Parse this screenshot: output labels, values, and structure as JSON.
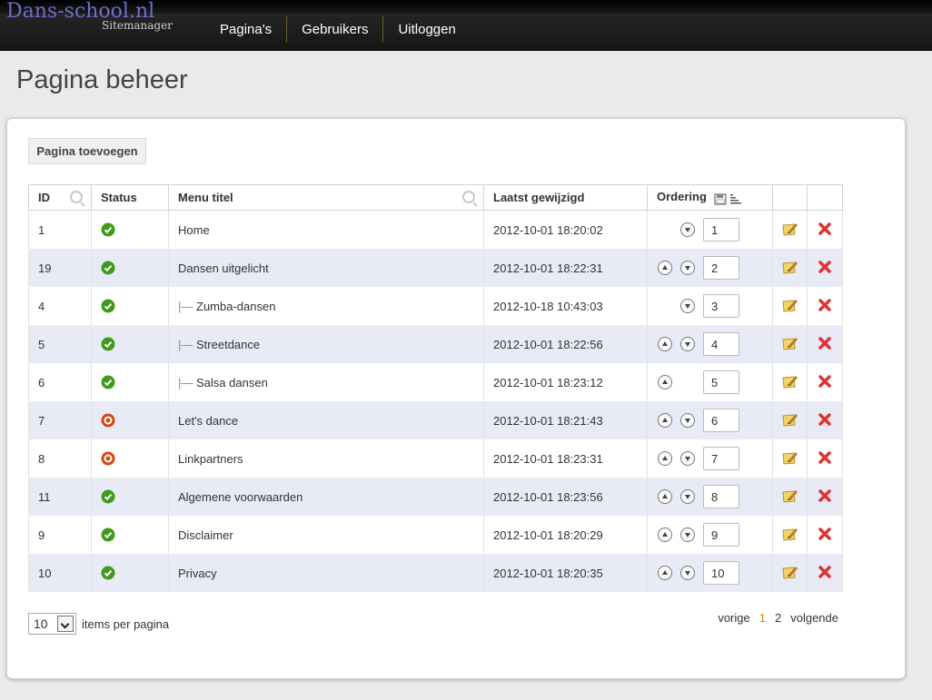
{
  "app": {
    "brand": "Dans-school.nl",
    "subtitle": "Sitemanager"
  },
  "nav": {
    "items": [
      "Pagina's",
      "Gebruikers",
      "Uitloggen"
    ]
  },
  "page": {
    "title": "Pagina beheer"
  },
  "toolbar": {
    "add_label": "Pagina toevoegen"
  },
  "table": {
    "columns": {
      "id": "ID",
      "status": "Status",
      "title": "Menu titel",
      "modified": "Laatst gewijzigd",
      "ordering": "Ordering"
    },
    "rows": [
      {
        "id": "1",
        "status": "active",
        "title": "Home",
        "child": false,
        "modified": "2012-10-01 18:20:02",
        "order": "1",
        "up": false,
        "down": true
      },
      {
        "id": "19",
        "status": "active",
        "title": "Dansen uitgelicht",
        "child": false,
        "modified": "2012-10-01 18:22:31",
        "order": "2",
        "up": true,
        "down": true
      },
      {
        "id": "4",
        "status": "active",
        "title": "Zumba-dansen",
        "child": true,
        "modified": "2012-10-18 10:43:03",
        "order": "3",
        "up": false,
        "down": true
      },
      {
        "id": "5",
        "status": "active",
        "title": "Streetdance",
        "child": true,
        "modified": "2012-10-01 18:22:56",
        "order": "4",
        "up": true,
        "down": true
      },
      {
        "id": "6",
        "status": "active",
        "title": "Salsa dansen",
        "child": true,
        "modified": "2012-10-01 18:23:12",
        "order": "5",
        "up": true,
        "down": false
      },
      {
        "id": "7",
        "status": "inactive",
        "title": "Let's dance",
        "child": false,
        "modified": "2012-10-01 18:21:43",
        "order": "6",
        "up": true,
        "down": true
      },
      {
        "id": "8",
        "status": "inactive",
        "title": "Linkpartners",
        "child": false,
        "modified": "2012-10-01 18:23:31",
        "order": "7",
        "up": true,
        "down": true
      },
      {
        "id": "11",
        "status": "active",
        "title": "Algemene voorwaarden",
        "child": false,
        "modified": "2012-10-01 18:23:56",
        "order": "8",
        "up": true,
        "down": true
      },
      {
        "id": "9",
        "status": "active",
        "title": "Disclaimer",
        "child": false,
        "modified": "2012-10-01 18:20:29",
        "order": "9",
        "up": true,
        "down": true
      },
      {
        "id": "10",
        "status": "active",
        "title": "Privacy",
        "child": false,
        "modified": "2012-10-01 18:20:35",
        "order": "10",
        "up": true,
        "down": true
      }
    ]
  },
  "tree_prefix": "|—",
  "pagination": {
    "per_page_value": "10",
    "per_page_label": "items per pagina",
    "prev": "vorige",
    "pages": [
      "1",
      "2"
    ],
    "current": "1",
    "next": "volgende"
  },
  "colors": {
    "active": "#3f9b1c",
    "inactive": "#d24a12",
    "delete": "#d33",
    "edit": "#e8c74a",
    "current_page": "#d48a0a"
  }
}
